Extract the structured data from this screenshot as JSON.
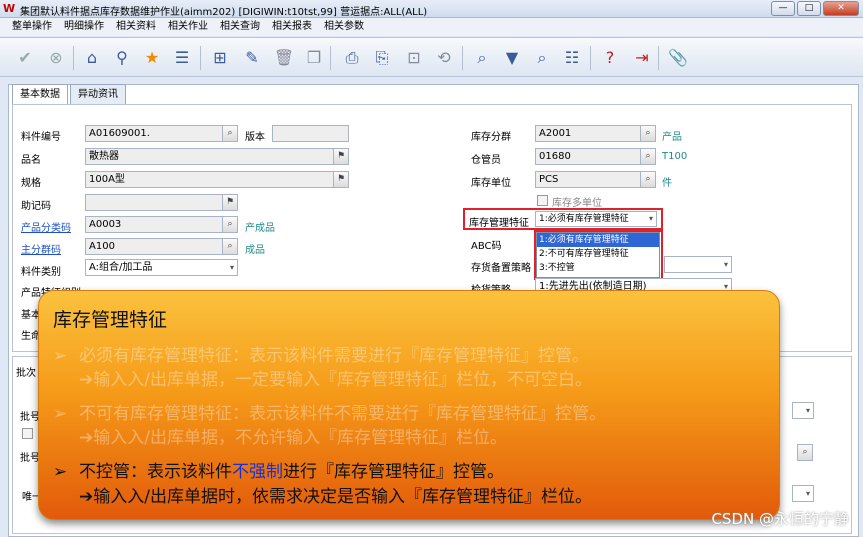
{
  "window": {
    "title": "集团默认料件据点库存数据维护作业(aimm202)    [DIGIWIN:t10tst,99]    营运据点:ALL(ALL)",
    "buttons": [
      "—",
      "□",
      "✕"
    ]
  },
  "menu": [
    "整单操作",
    "明细操作",
    "相关资料",
    "相关作业",
    "相关查询",
    "相关报表",
    "相关参数"
  ],
  "toolbar_icons": [
    "confirm-icon",
    "cancel-icon",
    "home-icon",
    "location-icon",
    "favorite-icon",
    "list-icon",
    "add-icon",
    "edit-icon",
    "delete-icon",
    "copy-icon",
    "print-icon",
    "export-icon",
    "attachment-icon",
    "refresh-icon",
    "search-icon",
    "filter-icon",
    "query-icon",
    "help-icon",
    "exit-icon",
    "clip-icon"
  ],
  "tabs": [
    "基本数据",
    "异动资讯"
  ],
  "form_left": {
    "item_no": {
      "label": "料件编号",
      "value": "A01609001."
    },
    "version": {
      "label": "版本",
      "value": ""
    },
    "name": {
      "label": "品名",
      "value": "散热器"
    },
    "spec": {
      "label": "规格",
      "value": "100A型"
    },
    "mnemonic": {
      "label": "助记码",
      "value": ""
    },
    "product_class": {
      "label": "产品分类码",
      "value": "A0003",
      "hint": "产成品"
    },
    "main_group": {
      "label": "主分群码",
      "value": "A100",
      "hint": "成品"
    },
    "item_type": {
      "label": "料件类别",
      "value": "A:组合/加工品"
    },
    "product_feature": {
      "label": "产品特征组别"
    },
    "basic_unit": {
      "label": "基本"
    },
    "life": {
      "label": "生命"
    }
  },
  "form_right": {
    "stock_group": {
      "label": "库存分群",
      "value": "A2001",
      "hint": "产品"
    },
    "keeper": {
      "label": "仓管员",
      "value": "01680",
      "hint": "T100"
    },
    "stock_unit": {
      "label": "库存单位",
      "value": "PCS",
      "hint": "件"
    },
    "multi_unit": {
      "label": "库存多单位"
    },
    "stock_feature": {
      "label": "库存管理特征",
      "value": "1:必须有库存管理特征"
    },
    "abc": {
      "label": "ABC码"
    },
    "backup": {
      "label": "存货备置策略"
    },
    "fifo": {
      "label": "检货策略",
      "value": "1:先进先出(依制造日期)"
    }
  },
  "dropdown_options": [
    "1:必须有库存管理特征",
    "2:不可有库存管理特征",
    "3:不控管"
  ],
  "lower_labels": [
    "批次",
    "批号",
    "批号",
    "唯一"
  ],
  "callout": {
    "title": "库存管理特征",
    "item1_line1": "必须有库存管理特征：表示该料件需要进行『库存管理特征』控管。",
    "item1_line2": "➔输入入/出库单据，一定要输入『库存管理特征』栏位，不可空白。",
    "item2_line1": "不可有库存管理特征：表示该料件不需要进行『库存管理特征』控管。",
    "item2_line2": "➔输入入/出库单据，不允许输入『库存管理特征』栏位。",
    "item3_a": "不控管：表示该料件",
    "item3_b": "不强制",
    "item3_c": "进行『库存管理特征』控管。",
    "item3_line2": "➔输入入/出库单据时，依需求决定是否输入『库存管理特征』栏位。",
    "bullet": "➢"
  },
  "watermark": "CSDN @永恒的宁静"
}
